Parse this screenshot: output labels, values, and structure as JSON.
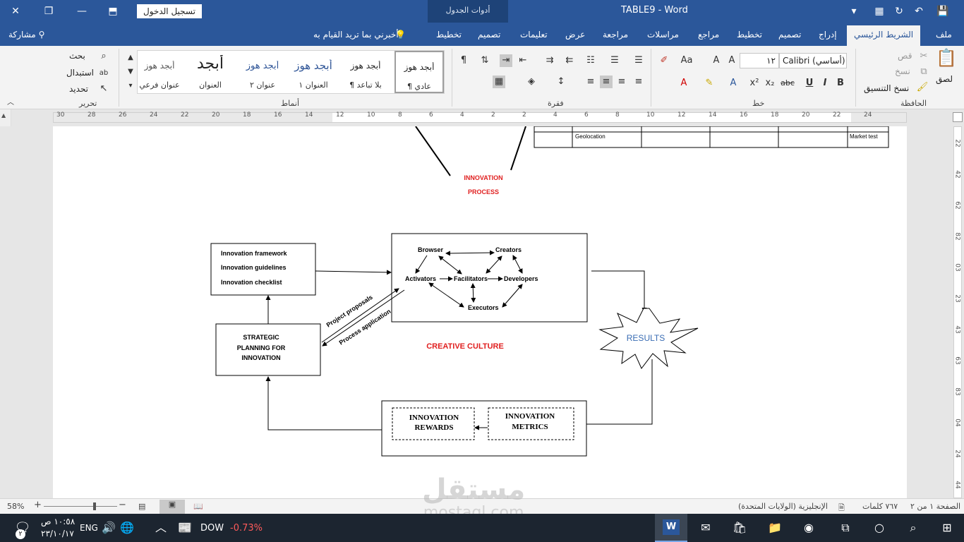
{
  "titlebar": {
    "doc_title": "TABLE9  -  Word",
    "context_tab": "أدوات الجدول",
    "signin": "تسجيل الدخول"
  },
  "tabs": {
    "file": "ملف",
    "home": "الشريط الرئيسي",
    "insert": "إدراج",
    "design": "تصميم",
    "layout": "تخطيط",
    "references": "مراجع",
    "mailings": "مراسلات",
    "review": "مراجعة",
    "view": "عرض",
    "help": "تعليمات",
    "table_design": "تصميم",
    "table_layout": "تخطيط",
    "tell_me": "أخبرني بما تريد القيام به",
    "share": "مشاركة"
  },
  "ribbon": {
    "clipboard": {
      "paste": "لصق",
      "cut": "قص",
      "copy": "نسخ",
      "format_painter": "نسخ التنسيق",
      "label": "الحافظة"
    },
    "font": {
      "name": "Calibri (أساسي)",
      "size": "١٢",
      "label": "خط",
      "bold": "B",
      "italic": "I",
      "underline": "U",
      "strike": "abc",
      "sub": "x₂",
      "sup": "x²"
    },
    "paragraph": {
      "label": "فقرة"
    },
    "styles": {
      "label": "أنماط",
      "items": [
        {
          "preview": "أبجد هوز",
          "name": "¶ عادي"
        },
        {
          "preview": "أبجد هوز",
          "name": "¶ بلا تباعد"
        },
        {
          "preview": "أبجد هوز",
          "name": "العنوان ١"
        },
        {
          "preview": "أبجد هوز",
          "name": "عنوان ٢"
        },
        {
          "preview": "أبجد",
          "name": "العنوان"
        },
        {
          "preview": "أبجد هوز",
          "name": "عنوان فرعي"
        }
      ]
    },
    "editing": {
      "find": "بحث",
      "replace": "استبدال",
      "select": "تحديد",
      "label": "تحرير"
    }
  },
  "ruler": {
    "numbers": [
      "30",
      "28",
      "26",
      "24",
      "22",
      "20",
      "18",
      "16",
      "14",
      "12",
      "10",
      "8",
      "6",
      "4",
      "2",
      "2",
      "4",
      "6",
      "8",
      "10",
      "12",
      "14",
      "16",
      "18",
      "20",
      "22",
      "24"
    ],
    "vnumbers": [
      "22",
      "42",
      "62",
      "82",
      "03",
      "23",
      "43",
      "63",
      "83",
      "04",
      "24",
      "44"
    ]
  },
  "document": {
    "table": {
      "cell_left": "Geolocation",
      "cell_right": "Market test"
    },
    "innovation_process": [
      "INNOVATION",
      "PROCESS"
    ],
    "framework_box": [
      "Innovation framework",
      "Innovation guidelines",
      "Innovation checklist"
    ],
    "strategic_box": [
      "STRATEGIC",
      "PLANNING FOR",
      "INNOVATION"
    ],
    "culture_nodes": {
      "browser": "Browser",
      "creators": "Creators",
      "activators": "Activators",
      "facilitators": "Facilitators",
      "developers": "Developers",
      "executors": "Executors"
    },
    "creative_culture": "CREATIVE CULTURE",
    "project_proposals": "Project proposals",
    "process_application": "Process application",
    "results": "RESULTS",
    "rewards": [
      "INNOVATION",
      "REWARDS"
    ],
    "metrics": [
      "INNOVATION",
      "METRICS"
    ]
  },
  "status": {
    "page": "الصفحة ١ من ٢",
    "words": "٧٦٧ كلمات",
    "language": "الإنجليزية (الولايات المتحدة)",
    "zoom": "58%"
  },
  "taskbar": {
    "time": "١٠:٥٨ ص",
    "date": "٢٣/١٠/١٧",
    "lang": "ENG",
    "ticker": "DOW",
    "change": "-0.73%",
    "notif_count": "٢"
  },
  "watermark": {
    "arabic": "مستقل",
    "latin": "mostaql.com"
  },
  "colors": {
    "word_blue": "#2b579a",
    "red_text": "#e02020",
    "results_blue": "#3a6db4",
    "negative": "#ff5a5a"
  }
}
